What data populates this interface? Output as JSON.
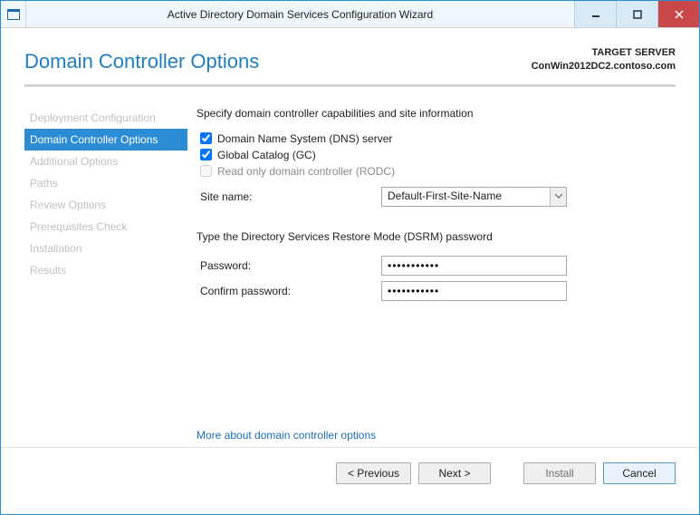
{
  "window": {
    "title": "Active Directory Domain Services Configuration Wizard"
  },
  "header": {
    "pageTitle": "Domain Controller Options",
    "targetLabel": "TARGET SERVER",
    "targetServer": "ConWin2012DC2.contoso.com"
  },
  "sidebar": {
    "steps": [
      "Deployment Configuration",
      "Domain Controller Options",
      "Additional Options",
      "Paths",
      "Review Options",
      "Prerequisites Check",
      "Installation",
      "Results"
    ],
    "activeIndex": 1
  },
  "content": {
    "capabilitiesHeading": "Specify domain controller capabilities and site information",
    "dnsLabel": "Domain Name System (DNS) server",
    "gcLabel": "Global Catalog (GC)",
    "rodcLabel": "Read only domain controller (RODC)",
    "dnsChecked": true,
    "gcChecked": true,
    "rodcChecked": false,
    "siteNameLabel": "Site name:",
    "siteNameValue": "Default-First-Site-Name",
    "dsrmHeading": "Type the Directory Services Restore Mode (DSRM) password",
    "passwordLabel": "Password:",
    "confirmLabel": "Confirm password:",
    "passwordValue": "•••••••••••",
    "confirmValue": "•••••••••••",
    "moreLink": "More about domain controller options"
  },
  "footer": {
    "previous": "< Previous",
    "next": "Next >",
    "install": "Install",
    "cancel": "Cancel"
  }
}
